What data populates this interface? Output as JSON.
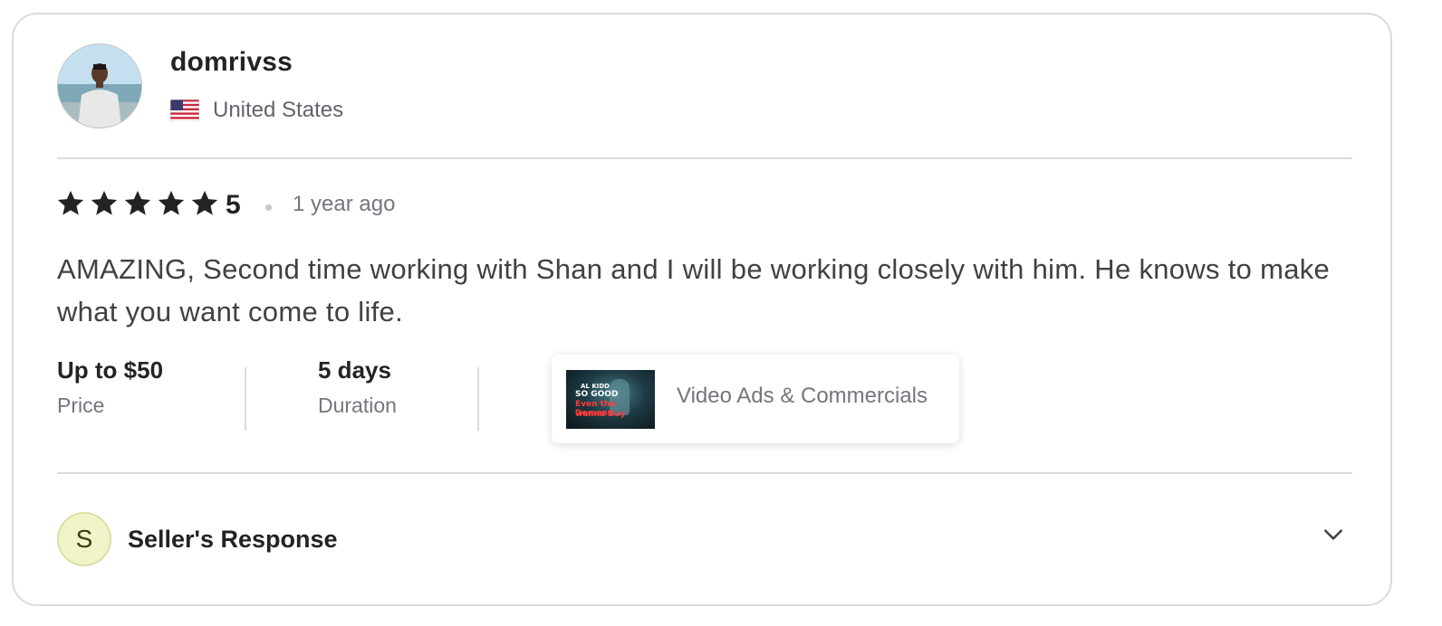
{
  "reviewer": {
    "username": "domrivss",
    "country": "United States",
    "flag_icon": "us-flag-icon",
    "avatar_icon": "profile-photo"
  },
  "rating": {
    "stars": 5,
    "value": "5",
    "time_ago": "1 year ago"
  },
  "review": {
    "text": "AMAZING, Second time working with Shan and I will be working closely with him. He knows to make what you want come to life."
  },
  "order_meta": {
    "price_value": "Up to $50",
    "price_label": "Price",
    "duration_value": "5 days",
    "duration_label": "Duration"
  },
  "gig": {
    "category": "Video Ads & Commercials",
    "thumb_line1": "AL KIDD",
    "thumb_line2": "SO GOOD",
    "thumb_line3": "Even the Demons",
    "thumb_line4": "wanna Buy"
  },
  "seller_response": {
    "initial": "S",
    "title": "Seller's Response",
    "toggle_icon": "chevron-down-icon"
  },
  "colors": {
    "star": "#222325",
    "border": "#dadbdd",
    "muted_text": "#74767e",
    "seller_badge_bg": "#f1f3c8"
  }
}
